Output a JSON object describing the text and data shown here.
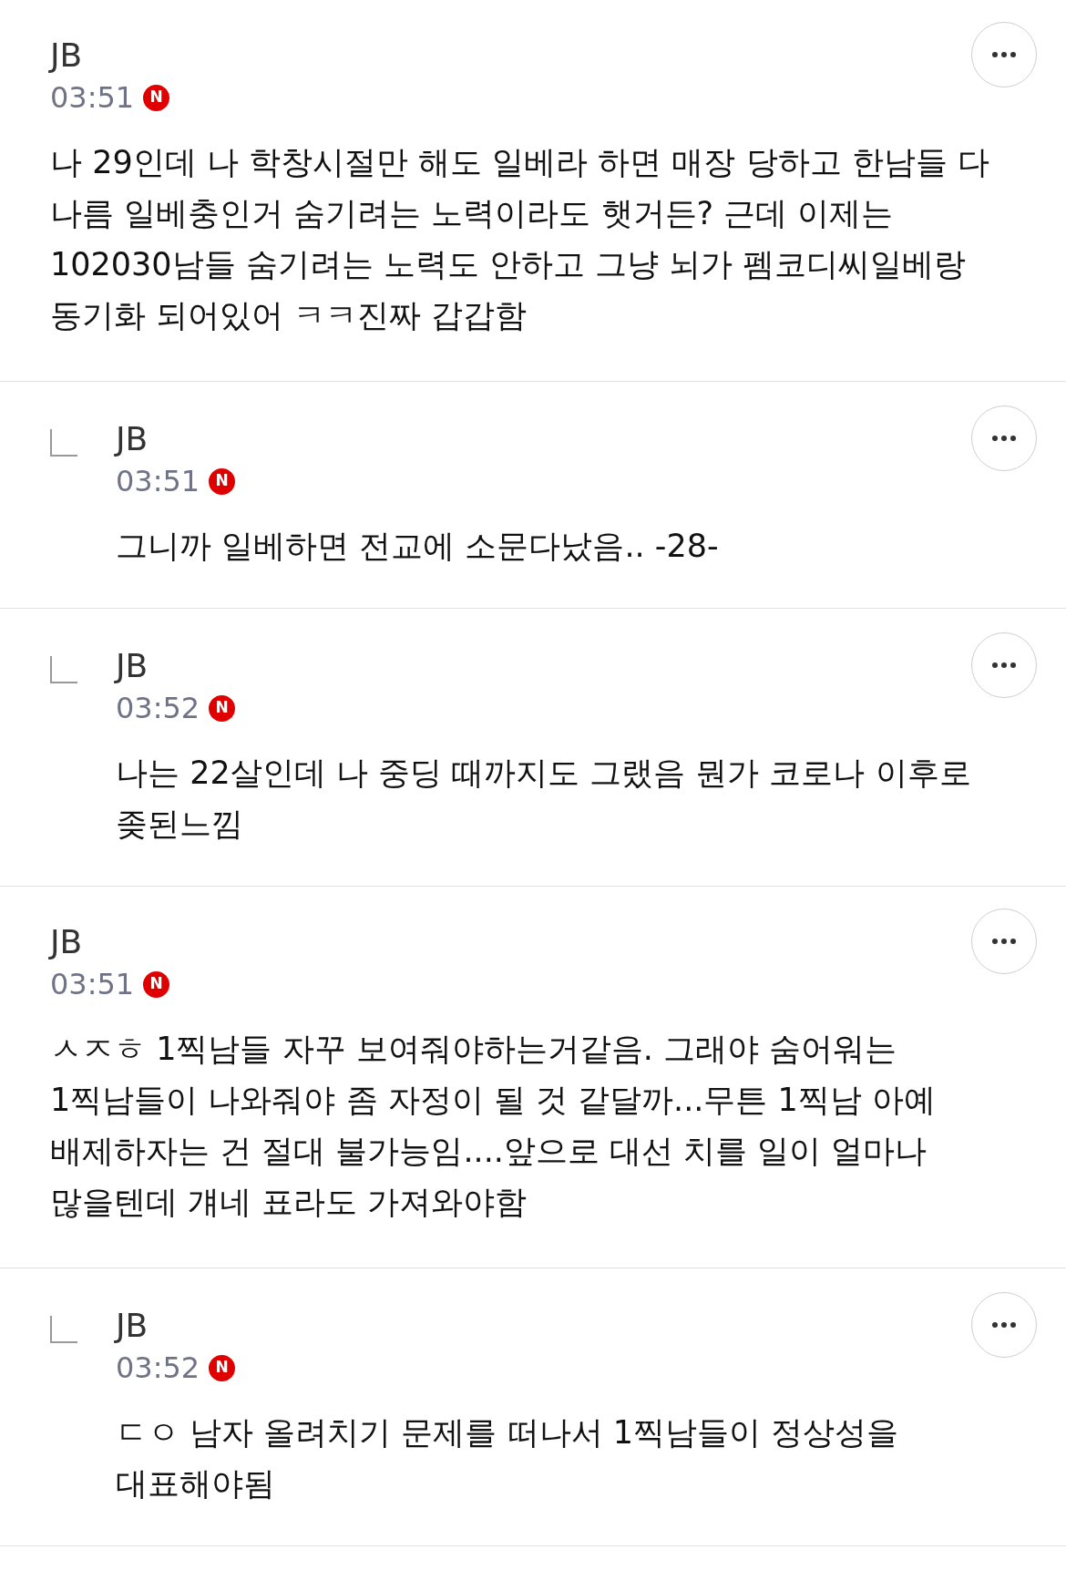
{
  "comments": [
    {
      "author": "JB",
      "time": "03:51",
      "badge": "N",
      "text": "나 29인데 나 학창시절만 해도 일베라 하면 매장 당하고 한남들 다 나름 일베충인거 숨기려는 노력이라도 햇거든? 근데 이제는 102030남들 숨기려는 노력도 안하고 그냥 뇌가 펨코디씨일베랑 동기화 되어있어 ㅋㅋ진짜 갑갑함",
      "children": [
        {
          "author": "JB",
          "time": "03:51",
          "badge": "N",
          "text": "그니까 일베하면 전교에 소문다났음.. -28-"
        },
        {
          "author": "JB",
          "time": "03:52",
          "badge": "N",
          "text": "나는 22살인데 나 중딩 때까지도 그랬음 뭔가 코로나 이후로 좆된느낌"
        }
      ]
    },
    {
      "author": "JB",
      "time": "03:51",
      "badge": "N",
      "text": "ㅅㅈㅎ 1찍남들 자꾸 보여줘야하는거같음. 그래야 숨어워는 1찍남들이 나와줘야 좀 자정이 될 것 같달까...무튼 1찍남 아예 배제하자는 건 절대 불가능임....앞으로 대선 치를 일이 얼마나 많을텐데 걔네 표라도 가져와야함",
      "children": [
        {
          "author": "JB",
          "time": "03:52",
          "badge": "N",
          "text": "ㄷㅇ 남자 올려치기 문제를 떠나서 1찍남들이 정상성을 대표해야됨"
        }
      ]
    }
  ]
}
